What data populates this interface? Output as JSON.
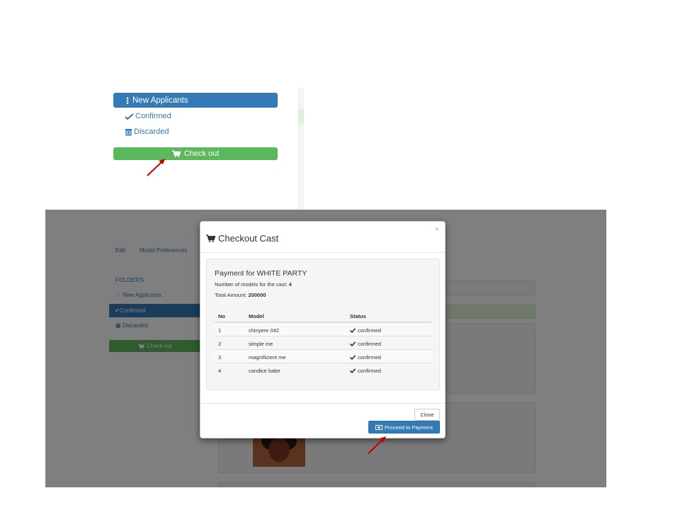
{
  "inset": {
    "new_applicants_label": "New Applicants",
    "confirmed_label": "Confirmed",
    "discarded_label": "Discarded",
    "checkout_label": "Check out"
  },
  "background": {
    "tab_edit": "Edit",
    "tab_model_preferences": "Model Preferences",
    "folders_heading": "FOLDERS",
    "new_applicants_label": "New Applicants",
    "confirmed_label": "Confirmed",
    "discarded_label": "Discarded",
    "checkout_label": "Check out"
  },
  "modal": {
    "close_x": "×",
    "title": "Checkout Cast",
    "payment_title": "Payment for WHITE PARTY",
    "models_count_label": "Number of models for the cast:",
    "models_count": "4",
    "total_amount_label": "Total Amount:",
    "total_amount": "200000",
    "table": {
      "headers": [
        "No",
        "Model",
        "Status"
      ],
      "rows": [
        {
          "no": "1",
          "model": "chinyere 042",
          "status": "confirmed"
        },
        {
          "no": "2",
          "model": "simple me",
          "status": "confirmed"
        },
        {
          "no": "3",
          "model": "magnificient me",
          "status": "confirmed"
        },
        {
          "no": "4",
          "model": "candice babe",
          "status": "confirmed"
        }
      ]
    },
    "close_button": "Close",
    "proceed_button": "Proceed to Payment"
  },
  "colors": {
    "primary": "#337ab7",
    "success": "#5cb85c",
    "annotation_arrow": "#c00000"
  }
}
